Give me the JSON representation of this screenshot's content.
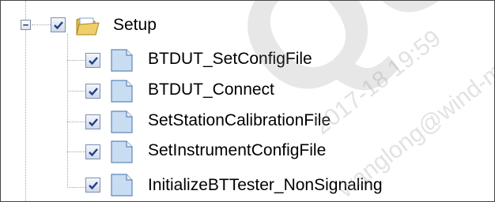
{
  "tree": {
    "root": {
      "label": "Setup",
      "expander_symbol": "−",
      "checked": true,
      "icon": "open-folder-icon"
    },
    "children": [
      {
        "label": "BTDUT_SetConfigFile",
        "checked": true,
        "icon": "document-icon"
      },
      {
        "label": "BTDUT_Connect",
        "checked": true,
        "icon": "document-icon"
      },
      {
        "label": "SetStationCalibrationFile",
        "checked": true,
        "icon": "document-icon"
      },
      {
        "label": "SetInstrumentConfigFile",
        "checked": true,
        "icon": "document-icon"
      },
      {
        "label": "InitializeBTTester_NonSignaling",
        "checked": true,
        "icon": "document-icon"
      }
    ]
  },
  "watermark": {
    "large_text": "QUA",
    "date_text": "2017-18 19:59",
    "user_text": "wanglong@wind-mobi"
  },
  "colors": {
    "tree_line": "#9aa6b8",
    "checkbox_border": "#7b8fb3",
    "check_mark": "#1d3f8a",
    "doc_fill": "#c9ddf2",
    "folder_fill": "#e9c45a"
  }
}
